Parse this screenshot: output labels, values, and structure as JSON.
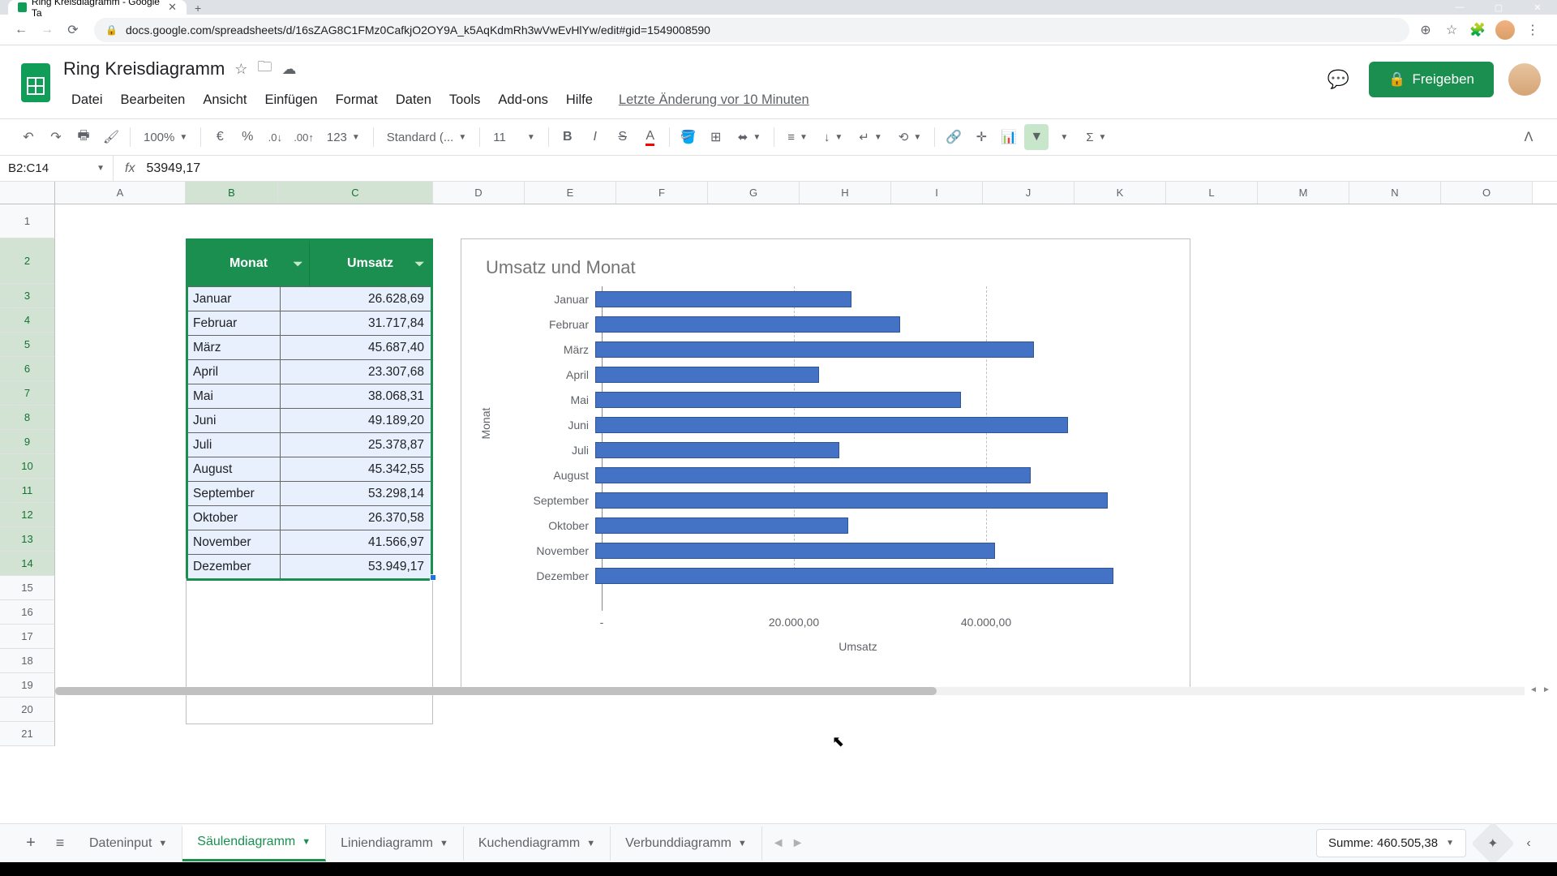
{
  "browser": {
    "tab_title": "Ring Kreisdiagramm - Google Ta",
    "url": "docs.google.com/spreadsheets/d/16sZAG8C1FMz0CafkjO2OY9A_k5AqKdmRh3wVwEvHlYw/edit#gid=1549008590"
  },
  "doc": {
    "title": "Ring Kreisdiagramm",
    "last_edit": "Letzte Änderung vor 10 Minuten"
  },
  "menus": {
    "file": "Datei",
    "edit": "Bearbeiten",
    "view": "Ansicht",
    "insert": "Einfügen",
    "format": "Format",
    "data": "Daten",
    "tools": "Tools",
    "addons": "Add-ons",
    "help": "Hilfe"
  },
  "toolbar": {
    "zoom": "100%",
    "currency": "€",
    "percent": "%",
    "dec_dec": ".0",
    "dec_inc": ".00",
    "numfmt": "123",
    "font": "Standard (...",
    "size": "11"
  },
  "share": {
    "label": "Freigeben"
  },
  "namebox": "B2:C14",
  "formula": "53949,17",
  "columns": [
    "A",
    "B",
    "C",
    "D",
    "E",
    "F",
    "G",
    "H",
    "I",
    "J",
    "K",
    "L",
    "M",
    "N",
    "O"
  ],
  "table_header": {
    "col1": "Monat",
    "col2": "Umsatz"
  },
  "table_rows": [
    {
      "m": "Januar",
      "v": "26.628,69"
    },
    {
      "m": "Februar",
      "v": "31.717,84"
    },
    {
      "m": "März",
      "v": "45.687,40"
    },
    {
      "m": "April",
      "v": "23.307,68"
    },
    {
      "m": "Mai",
      "v": "38.068,31"
    },
    {
      "m": "Juni",
      "v": "49.189,20"
    },
    {
      "m": "Juli",
      "v": "25.378,87"
    },
    {
      "m": "August",
      "v": "45.342,55"
    },
    {
      "m": "September",
      "v": "53.298,14"
    },
    {
      "m": "Oktober",
      "v": "26.370,58"
    },
    {
      "m": "November",
      "v": "41.566,97"
    },
    {
      "m": "Dezember",
      "v": "53.949,17"
    }
  ],
  "chart": {
    "title": "Umsatz und Monat",
    "ylabel": "Monat",
    "xlabel": "Umsatz",
    "xticks": [
      "-",
      "20.000,00",
      "40.000,00"
    ]
  },
  "chart_data": {
    "type": "bar",
    "orientation": "horizontal",
    "categories": [
      "Januar",
      "Februar",
      "März",
      "April",
      "Mai",
      "Juni",
      "Juli",
      "August",
      "September",
      "Oktober",
      "November",
      "Dezember"
    ],
    "values": [
      26628.69,
      31717.84,
      45687.4,
      23307.68,
      38068.31,
      49189.2,
      25378.87,
      45342.55,
      53298.14,
      26370.58,
      41566.97,
      53949.17
    ],
    "title": "Umsatz und Monat",
    "xlabel": "Umsatz",
    "ylabel": "Monat",
    "xlim": [
      0,
      60000
    ],
    "xticks": [
      0,
      20000,
      40000
    ]
  },
  "sheets": {
    "tab1": "Dateninput",
    "tab2": "Säulendiagramm",
    "tab3": "Liniendiagramm",
    "tab4": "Kuchendiagramm",
    "tab5": "Verbunddiagramm"
  },
  "summary": "Summe: 460.505,38"
}
